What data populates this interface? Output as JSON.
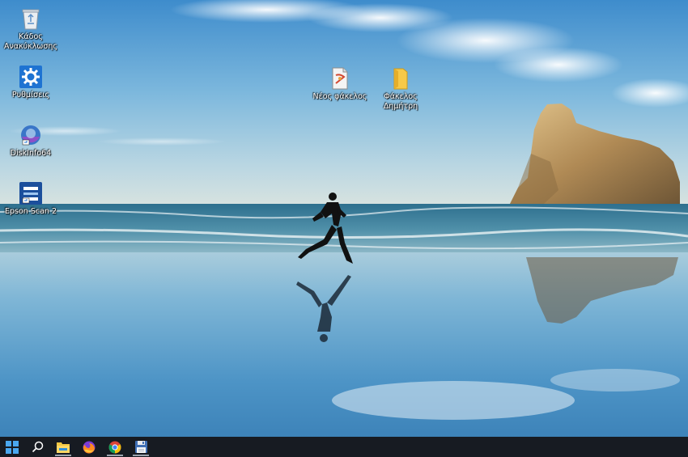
{
  "desktop": {
    "icons": [
      {
        "name": "recycle-bin",
        "label": "Κάδος\nΑνακύκλωσης",
        "icon": "recycle-bin-icon"
      },
      {
        "name": "settings",
        "label": "Ρυθμίσεις",
        "icon": "gear-icon"
      },
      {
        "name": "diskinfo",
        "label": "DiskInfo64",
        "icon": "diskinfo-icon"
      },
      {
        "name": "epson-scan",
        "label": "Epson Scan 2",
        "icon": "scanner-icon"
      },
      {
        "name": "new-folder-doc",
        "label": "Νέος φάκελος",
        "icon": "document-icon"
      },
      {
        "name": "folder-dimitri",
        "label": "Φάκελος\nΔημήτρη",
        "icon": "folder-icon"
      }
    ]
  },
  "taskbar": {
    "items": [
      {
        "name": "start",
        "icon": "windows-start-icon",
        "running": false
      },
      {
        "name": "search",
        "icon": "search-icon",
        "running": false
      },
      {
        "name": "file-explorer",
        "icon": "file-explorer-icon",
        "running": true
      },
      {
        "name": "firefox",
        "icon": "firefox-icon",
        "running": false
      },
      {
        "name": "chrome",
        "icon": "chrome-icon",
        "running": true
      },
      {
        "name": "save-app",
        "icon": "floppy-disk-icon",
        "running": true
      }
    ],
    "background": "#171b22"
  },
  "colors": {
    "sky_top": "#3f8fcf",
    "sea": "#5d9bb5",
    "sand": "#6fb0d3"
  }
}
